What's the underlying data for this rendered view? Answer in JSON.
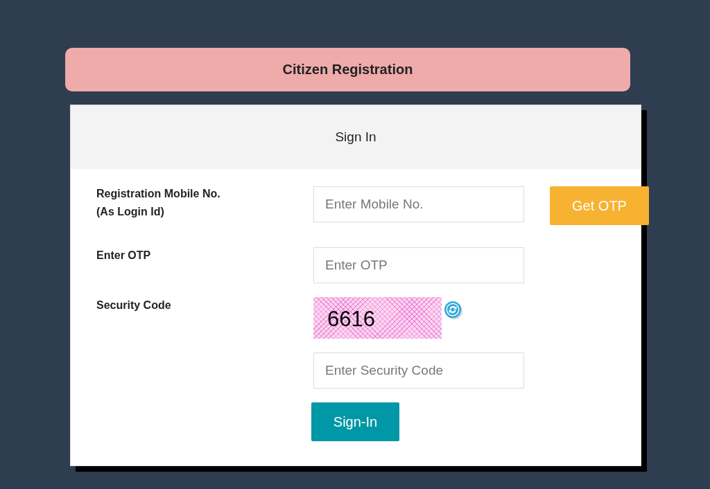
{
  "header": {
    "title": "Citizen Registration"
  },
  "panel": {
    "title": "Sign In"
  },
  "mobile": {
    "label": "Registration Mobile No.\n(As Login Id)",
    "placeholder": "Enter Mobile No.",
    "button": "Get OTP"
  },
  "otp": {
    "label": "Enter OTP",
    "placeholder": "Enter OTP"
  },
  "security": {
    "label": "Security Code",
    "captcha": "6616",
    "placeholder": "Enter Security Code"
  },
  "submit": {
    "label": "Sign-In"
  }
}
